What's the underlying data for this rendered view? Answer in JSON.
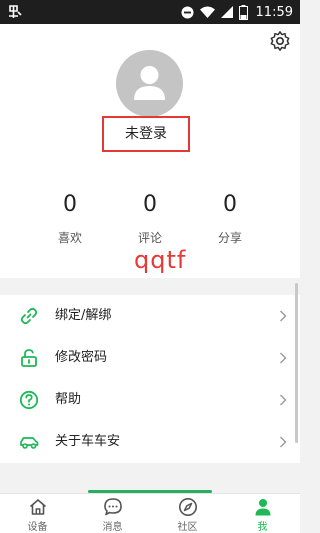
{
  "status_bar": {
    "time": "11:59",
    "battery": "15"
  },
  "profile": {
    "login_text": "未登录"
  },
  "stats": [
    {
      "value": "0",
      "label": "喜欢"
    },
    {
      "value": "0",
      "label": "评论"
    },
    {
      "value": "0",
      "label": "分享"
    }
  ],
  "watermark": "qqtf",
  "menu": [
    {
      "label": "绑定/解绑",
      "icon": "link-icon"
    },
    {
      "label": "修改密码",
      "icon": "unlock-icon"
    },
    {
      "label": "帮助",
      "icon": "help-icon"
    },
    {
      "label": "关于车车安",
      "icon": "car-icon"
    }
  ],
  "tabs": [
    {
      "label": "设备",
      "icon": "home-icon"
    },
    {
      "label": "消息",
      "icon": "message-icon"
    },
    {
      "label": "社区",
      "icon": "compass-icon"
    },
    {
      "label": "我",
      "icon": "person-icon",
      "active": true
    }
  ],
  "colors": {
    "accent": "#1db954",
    "highlight": "#e53935",
    "statusbar": "#1e1e1e"
  }
}
